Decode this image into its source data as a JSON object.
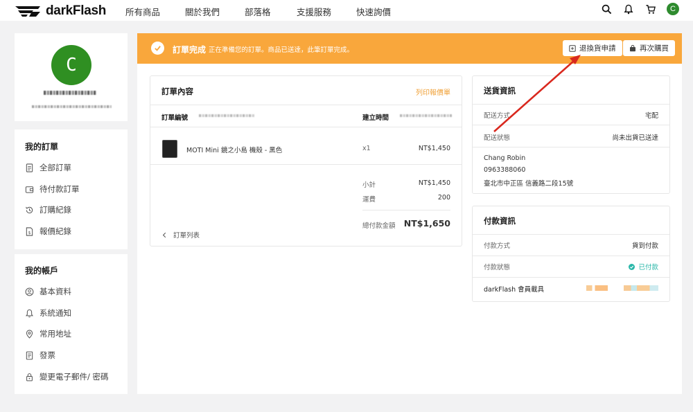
{
  "header": {
    "logo_text": "darkFlash",
    "nav": [
      "所有商品",
      "關於我們",
      "部落格",
      "支援服務",
      "快速詢價"
    ],
    "avatar_letter": "C"
  },
  "sidebar": {
    "avatar_letter": "C",
    "orders_title": "我的訂單",
    "orders": [
      "全部訂單",
      "待付款訂單",
      "訂購紀錄",
      "報價紀錄"
    ],
    "account_title": "我的帳戶",
    "account": [
      "基本資料",
      "系統通知",
      "常用地址",
      "發票",
      "變更電子郵件/ 密碼"
    ]
  },
  "banner": {
    "title": "訂單完成",
    "text": "正在準備您的訂單。商品已送達，此筆訂單完成。",
    "return_btn": "退換貨申請",
    "rebuy_btn": "再次購買",
    "color": "#f9a73c"
  },
  "order": {
    "title": "訂單內容",
    "print_link": "列印報價單",
    "order_no_label": "訂單編號",
    "created_label": "建立時間",
    "product_name": "MOTI Mini 鏡之小島 機殼 - 黑色",
    "qty": "x1",
    "price": "NT$1,450",
    "subtotal_label": "小計",
    "subtotal": "NT$1,450",
    "shipping_label": "運費",
    "shipping": "200",
    "total_label": "總付款金額",
    "total": "NT$1,650",
    "back_link": "訂單列表"
  },
  "shipping": {
    "title": "送貨資訊",
    "method_label": "配送方式",
    "method": "宅配",
    "status_label": "配送狀態",
    "status": "尚未出貨已送達",
    "name": "Chang Robin",
    "phone": "0963388060",
    "address": "臺北市中正區 信義路二段15號"
  },
  "payment": {
    "title": "付款資訊",
    "method_label": "付款方式",
    "method": "貨到付款",
    "status_label": "付款狀態",
    "status": "已付款",
    "status_color": "#2ab7a9",
    "carrier_label": "darkFlash 會員載具"
  },
  "annotation": {
    "arrow_color": "#d9281e"
  }
}
